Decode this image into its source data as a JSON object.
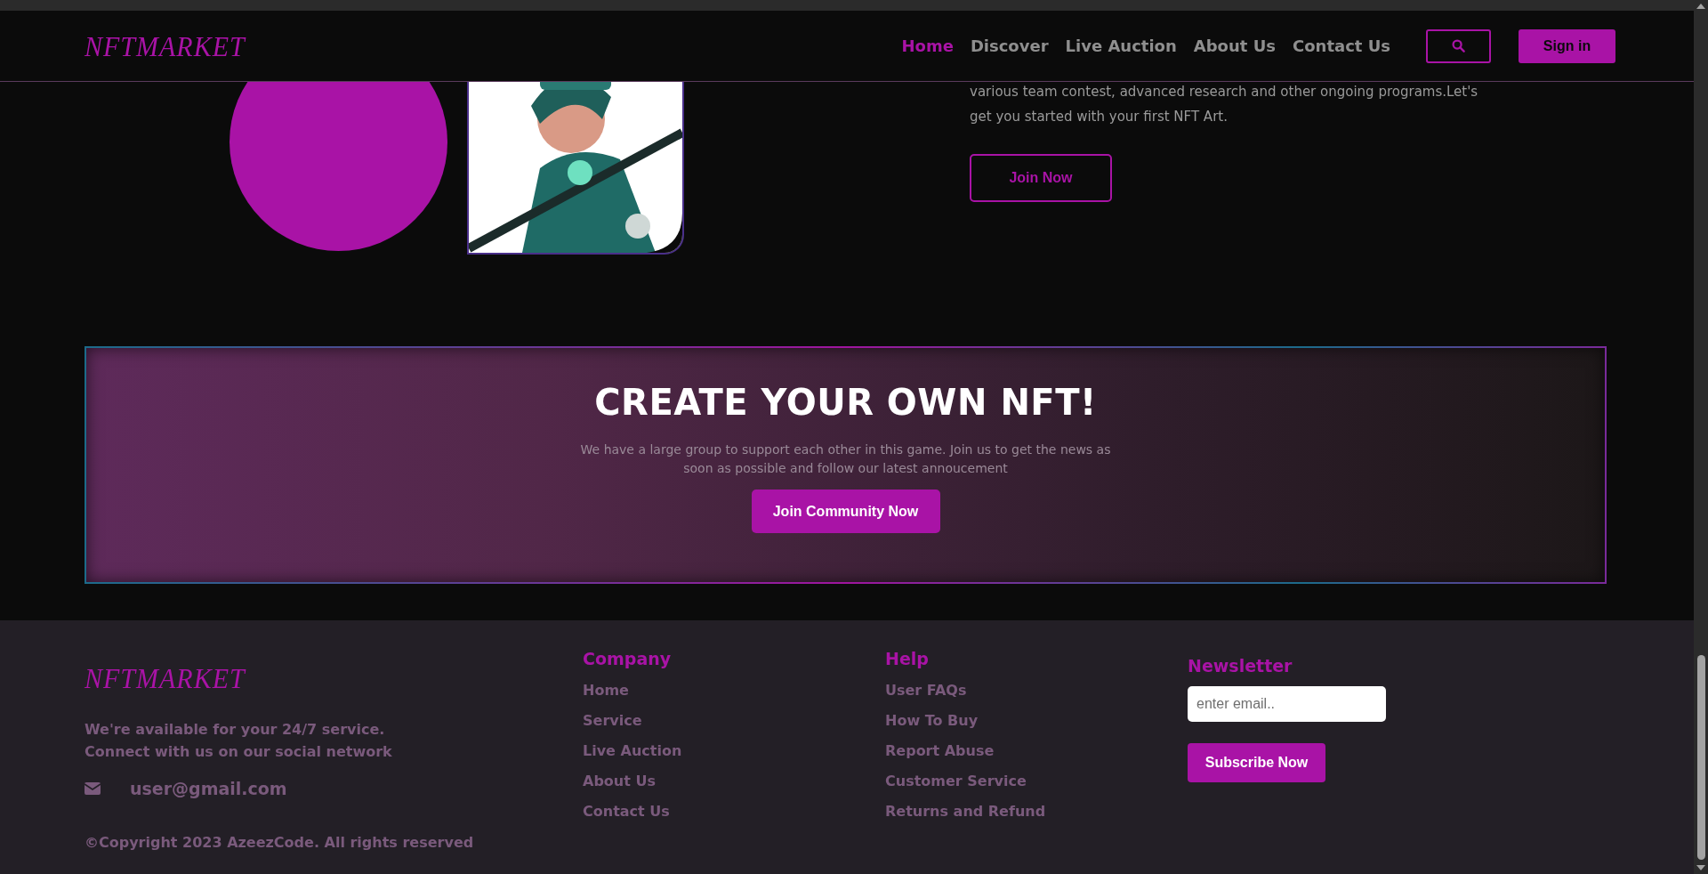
{
  "header": {
    "logo": "NFTMARKET",
    "nav": [
      {
        "label": "Home",
        "selected": true
      },
      {
        "label": "Discover",
        "selected": false
      },
      {
        "label": "Live Auction",
        "selected": false
      },
      {
        "label": "About Us",
        "selected": false
      },
      {
        "label": "Contact Us",
        "selected": false
      }
    ],
    "sign_in": "Sign in"
  },
  "hero": {
    "text": "various team contest, advanced research and other ongoing programs.Let's\nget you started with your first NFT Art.",
    "button": "Join Now"
  },
  "banner": {
    "title": "CREATE YOUR OWN NFT!",
    "text": "We have a large group to support each other in this game. Join us to get the news as\nsoon as possible and follow our latest annoucement",
    "button": "Join Community Now"
  },
  "footer": {
    "logo": "NFTMARKET",
    "about": "We're available for your 24/7 service.\nConnect with us on our social network",
    "email": "user@gmail.com",
    "copyright": "©Copyright 2023 AzeezCode. All rights reserved",
    "columns": [
      {
        "heading": "Company",
        "links": [
          "Home",
          "Service",
          "Live Auction",
          "About Us",
          "Contact Us"
        ]
      },
      {
        "heading": "Help",
        "links": [
          "User FAQs",
          "How To Buy",
          "Report Abuse",
          "Customer Service",
          "Returns and Refund"
        ]
      }
    ],
    "newsletter": {
      "heading": "Newsletter",
      "placeholder": "enter email..",
      "button": "Subscribe Now"
    }
  }
}
